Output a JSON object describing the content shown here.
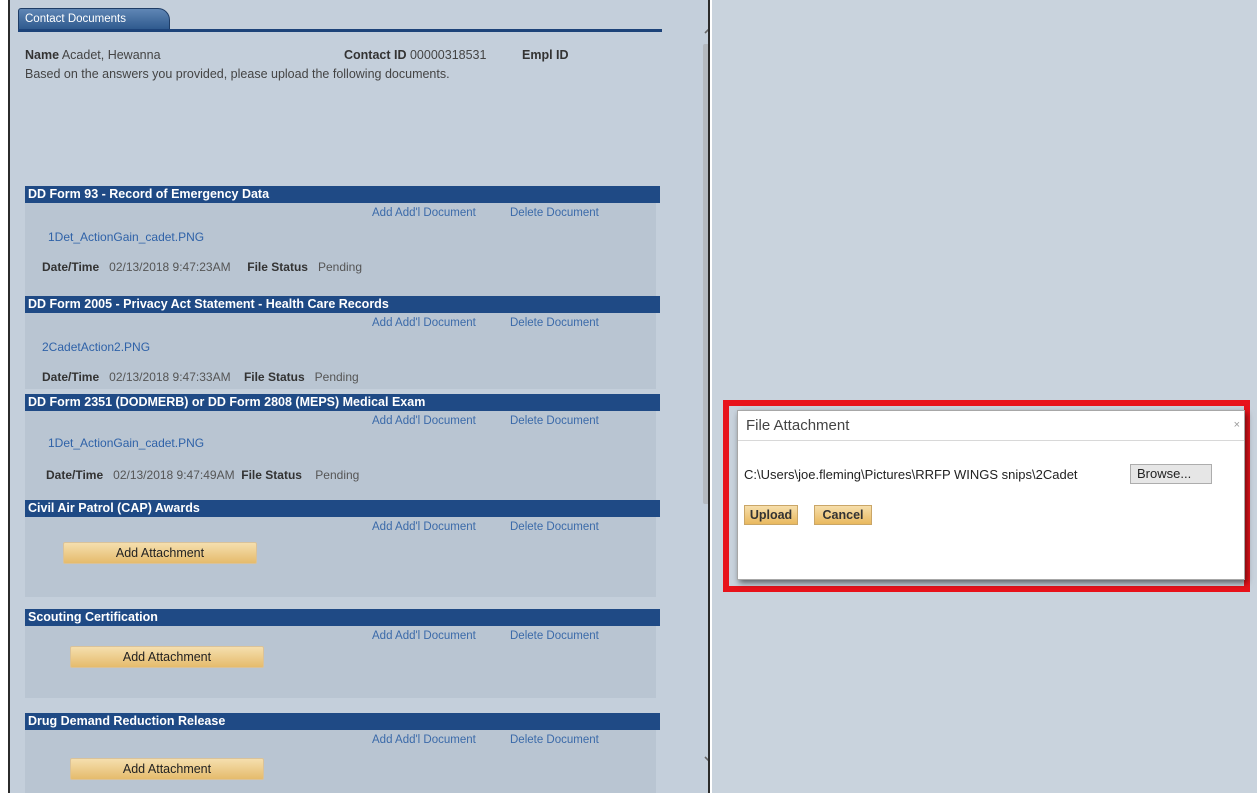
{
  "tab": {
    "label": "Contact Documents"
  },
  "contact": {
    "name_label": "Name",
    "name_value": "Acadet, Hewanna",
    "contact_id_label": "Contact ID",
    "contact_id_value": "00000318531",
    "empl_id_label": "Empl ID",
    "instructions": "Based on the answers you provided, please upload the following documents."
  },
  "links": {
    "add_doc": "Add Add'l Document",
    "delete_doc": "Delete Document"
  },
  "labels": {
    "datetime": "Date/Time",
    "file_status": "File Status",
    "add_attachment": "Add Attachment"
  },
  "sections": [
    {
      "title": "DD Form 93 - Record of Emergency Data",
      "file": "1Det_ActionGain_cadet.PNG",
      "datetime": "02/13/2018  9:47:23AM",
      "status": "Pending"
    },
    {
      "title": "DD Form 2005 - Privacy Act Statement - Health Care Records",
      "file": "2CadetAction2.PNG",
      "datetime": "02/13/2018  9:47:33AM",
      "status": "Pending"
    },
    {
      "title": "DD Form 2351 (DODMERB) or DD Form 2808 (MEPS) Medical Exam",
      "file": "1Det_ActionGain_cadet.PNG",
      "datetime": "02/13/2018  9:47:49AM",
      "status": "Pending"
    },
    {
      "title": "Civil Air Patrol (CAP) Awards"
    },
    {
      "title": "Scouting Certification"
    },
    {
      "title": "Drug Demand Reduction Release"
    }
  ],
  "dialog": {
    "title": "File Attachment",
    "close": "×",
    "file_path": "C:\\Users\\joe.fleming\\Pictures\\RRFP WINGS snips\\2Cadet",
    "browse": "Browse...",
    "upload": "Upload",
    "cancel": "Cancel"
  },
  "colors": {
    "header": "#1f4a85",
    "highlight": "#e8131b",
    "button": "#e5bb6c"
  }
}
